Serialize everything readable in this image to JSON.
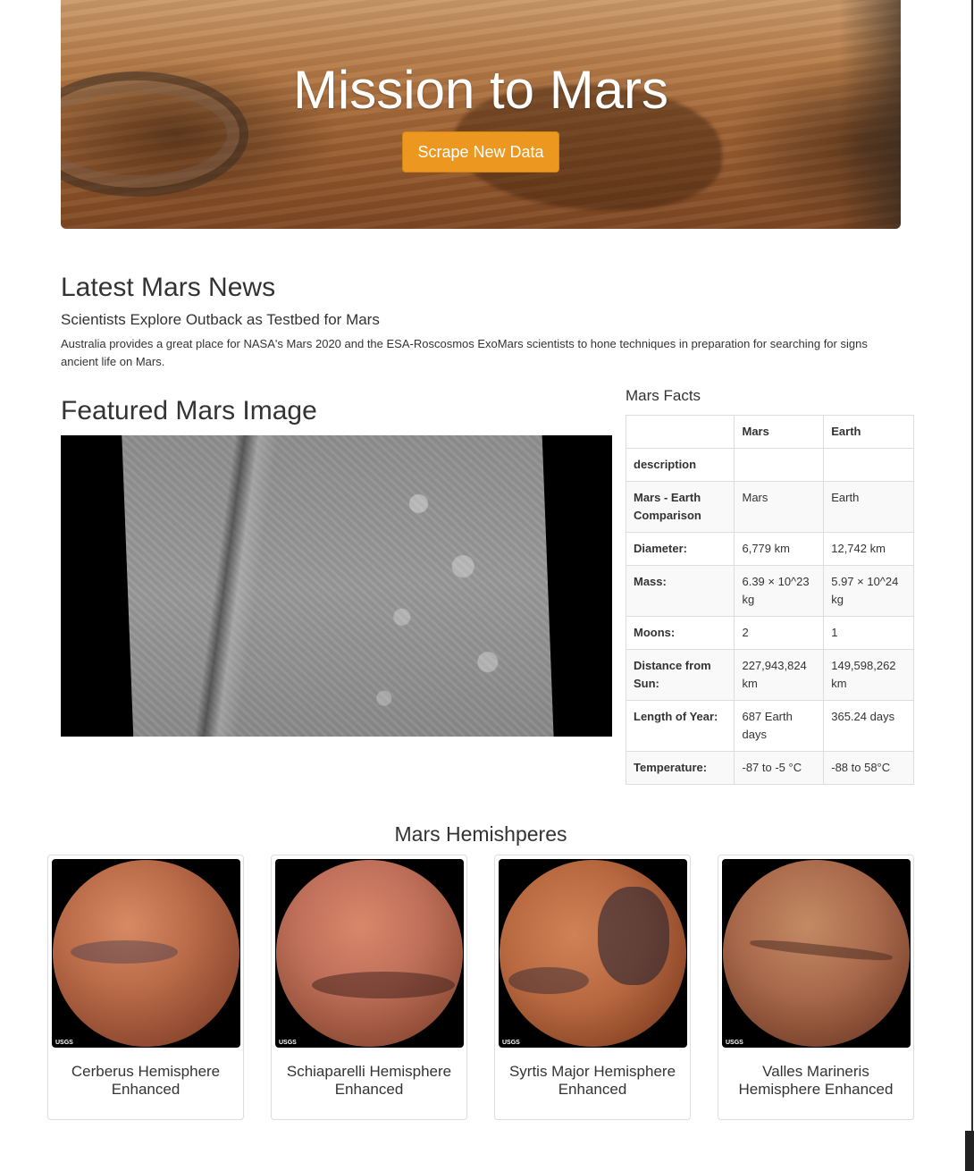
{
  "hero": {
    "title": "Mission to Mars",
    "button_label": "Scrape New Data",
    "button_color": "#ec971f"
  },
  "news": {
    "section_title": "Latest Mars News",
    "headline": "Scientists Explore Outback as Testbed for Mars",
    "teaser": "Australia provides a great place for NASA's Mars 2020 and the ESA-Roscosmos ExoMars scientists to hone techniques in preparation for searching for signs ancient life on Mars."
  },
  "featured": {
    "section_title": "Featured Mars Image"
  },
  "facts": {
    "section_title": "Mars Facts",
    "headers": [
      "",
      "Mars",
      "Earth"
    ],
    "rows": [
      {
        "label": "description",
        "mars": "",
        "earth": ""
      },
      {
        "label": "Mars - Earth Comparison",
        "mars": "Mars",
        "earth": "Earth"
      },
      {
        "label": "Diameter:",
        "mars": "6,779 km",
        "earth": "12,742 km"
      },
      {
        "label": "Mass:",
        "mars": "6.39 × 10^23 kg",
        "earth": "5.97 × 10^24 kg"
      },
      {
        "label": "Moons:",
        "mars": "2",
        "earth": "1"
      },
      {
        "label": "Distance from Sun:",
        "mars": "227,943,824 km",
        "earth": "149,598,262 km"
      },
      {
        "label": "Length of Year:",
        "mars": "687 Earth days",
        "earth": "365.24 days"
      },
      {
        "label": "Temperature:",
        "mars": "-87 to -5 °C",
        "earth": "-88 to 58°C"
      }
    ]
  },
  "hemispheres": {
    "section_title": "Mars Hemishperes",
    "items": [
      {
        "title": "Cerberus Hemisphere Enhanced",
        "logo": "USGS"
      },
      {
        "title": "Schiaparelli Hemisphere Enhanced",
        "logo": "USGS"
      },
      {
        "title": "Syrtis Major Hemisphere Enhanced",
        "logo": "USGS"
      },
      {
        "title": "Valles Marineris Hemisphere Enhanced",
        "logo": "USGS"
      }
    ]
  }
}
